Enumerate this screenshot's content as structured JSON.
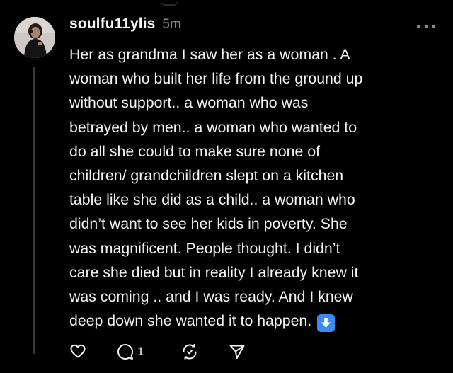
{
  "post": {
    "username": "soulfu11ylis",
    "timestamp": "5m",
    "lines": [
      "Her as grandma I saw her as a woman . A",
      "woman who built her life from the ground up",
      "without support.. a woman who was",
      "betrayed by men.. a woman who wanted to",
      "do all she could to make sure none of",
      "children/ grandchildren slept on a kitchen",
      "table like she did as a child.. a woman who",
      "didn’t want to see her kids in poverty. She",
      "was magnificent. People thought. I didn’t",
      "care she died but in reality I already knew it",
      "was coming .. and I was ready.  And I knew",
      "deep down she wanted it to happen."
    ],
    "end_emoji": "down-arrow-button-emoji"
  },
  "actions": {
    "like_icon": "heart-icon",
    "reply_icon": "comment-icon",
    "reply_count": "1",
    "repost_icon": "repost-icon",
    "share_icon": "send-icon"
  },
  "colors": {
    "background": "#000000",
    "text": "#f3f5f7",
    "muted": "#8a8a8a",
    "emoji_blue": "#3d8bf0",
    "thread_line": "#3a3a3a"
  }
}
